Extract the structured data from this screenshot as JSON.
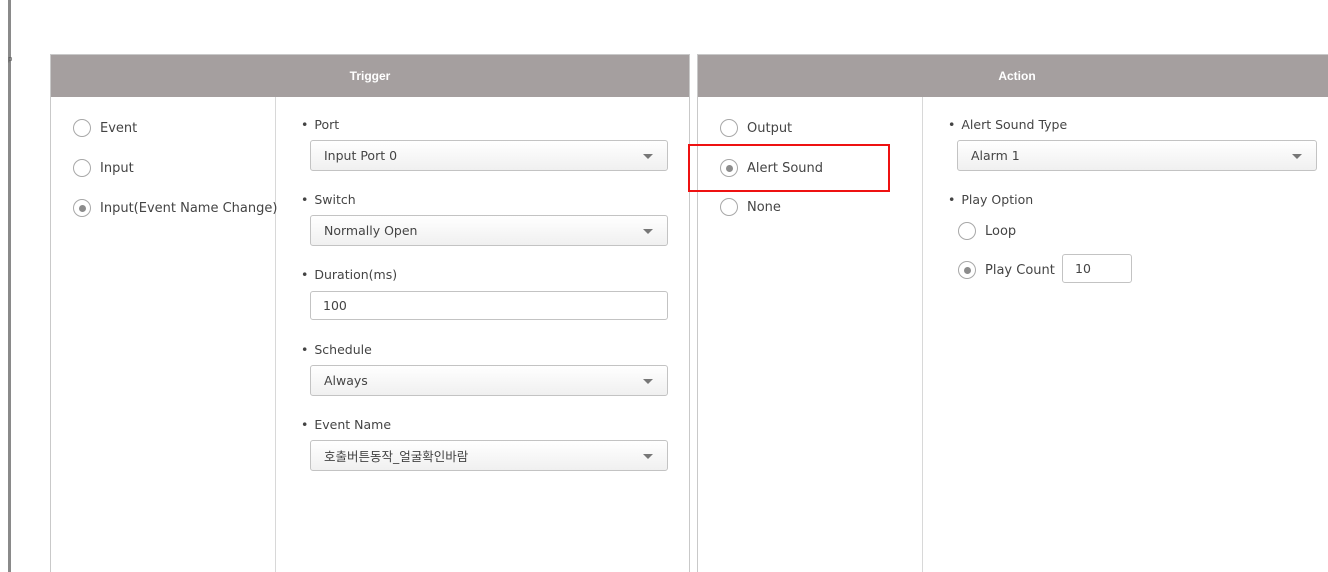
{
  "sidebar_mark": "p",
  "trigger": {
    "title": "Trigger",
    "options": [
      {
        "label": "Event",
        "checked": false
      },
      {
        "label": "Input",
        "checked": false
      },
      {
        "label": "Input(Event Name Change)",
        "checked": true
      }
    ],
    "fields": {
      "port": {
        "label": "Port",
        "value": "Input Port 0"
      },
      "switch": {
        "label": "Switch",
        "value": "Normally Open"
      },
      "duration": {
        "label": "Duration(ms)",
        "value": "100"
      },
      "schedule": {
        "label": "Schedule",
        "value": "Always"
      },
      "event_name": {
        "label": "Event Name",
        "value": "호출버튼동작_얼굴확인바람"
      }
    }
  },
  "action": {
    "title": "Action",
    "options": [
      {
        "label": "Output",
        "checked": false
      },
      {
        "label": "Alert Sound",
        "checked": true
      },
      {
        "label": "None",
        "checked": false
      }
    ],
    "fields": {
      "alert_sound_type": {
        "label": "Alert Sound Type",
        "value": "Alarm 1"
      },
      "play_option": {
        "label": "Play Option",
        "loop_label": "Loop",
        "loop_checked": false,
        "count_label": "Play Count",
        "count_checked": true,
        "count_value": "10"
      }
    }
  },
  "bullet": "•",
  "highlight_color": "#ee1111"
}
